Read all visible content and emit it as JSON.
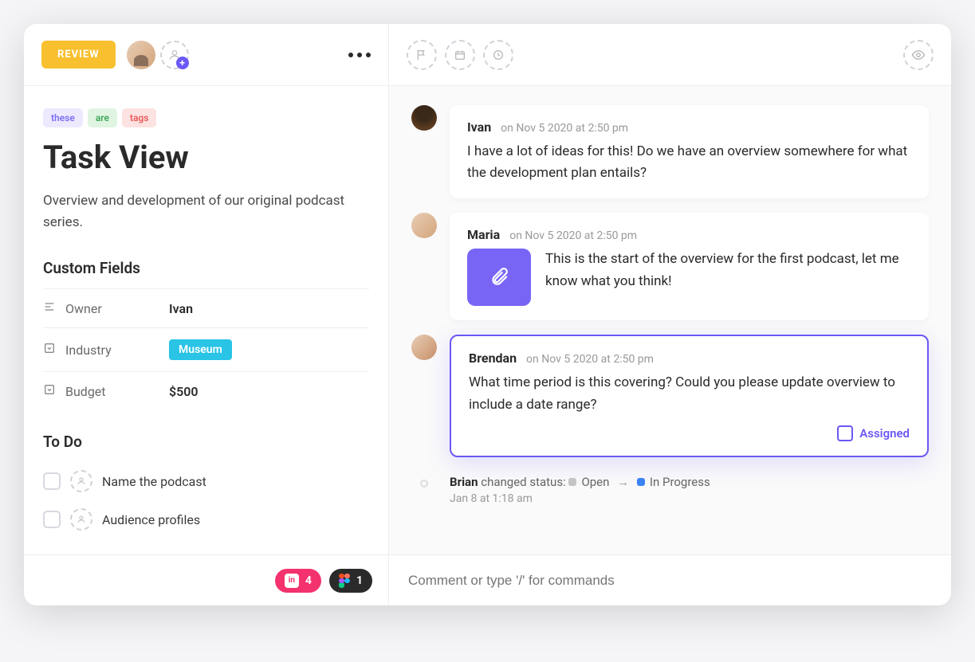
{
  "header": {
    "status_label": "REVIEW"
  },
  "tags": [
    "these",
    "are",
    "tags"
  ],
  "title": "Task View",
  "description": "Overview and development of our original podcast series.",
  "custom_fields": {
    "section_title": "Custom Fields",
    "rows": [
      {
        "label": "Owner",
        "value": "Ivan",
        "type": "text"
      },
      {
        "label": "Industry",
        "value": "Museum",
        "type": "chip"
      },
      {
        "label": "Budget",
        "value": "$500",
        "type": "text"
      }
    ]
  },
  "todo": {
    "section_title": "To Do",
    "items": [
      {
        "label": "Name the podcast"
      },
      {
        "label": "Audience profiles"
      }
    ]
  },
  "integrations": [
    {
      "name": "invision",
      "count": "4"
    },
    {
      "name": "figma",
      "count": "1"
    }
  ],
  "comments": [
    {
      "author": "Ivan",
      "meta": "on Nov 5 2020 at 2:50 pm",
      "body": "I have a lot of ideas for this! Do we have an overview somewhere for what the development plan entails?"
    },
    {
      "author": "Maria",
      "meta": "on Nov 5 2020 at 2:50 pm",
      "body": "This is the start of the overview for the first podcast, let me know what you think!",
      "has_attachment": true
    },
    {
      "author": "Brendan",
      "meta": "on Nov 5 2020 at 2:50 pm",
      "body": "What time period is this covering? Could you please update overview to include a date range?",
      "assigned_label": "Assigned",
      "highlighted": true
    }
  ],
  "activity": {
    "actor": "Brian",
    "action_text": "changed status:",
    "from_status": "Open",
    "to_status": "In Progress",
    "timestamp": "Jan 8 at 1:18 am"
  },
  "composer": {
    "placeholder": "Comment or type '/' for commands"
  }
}
